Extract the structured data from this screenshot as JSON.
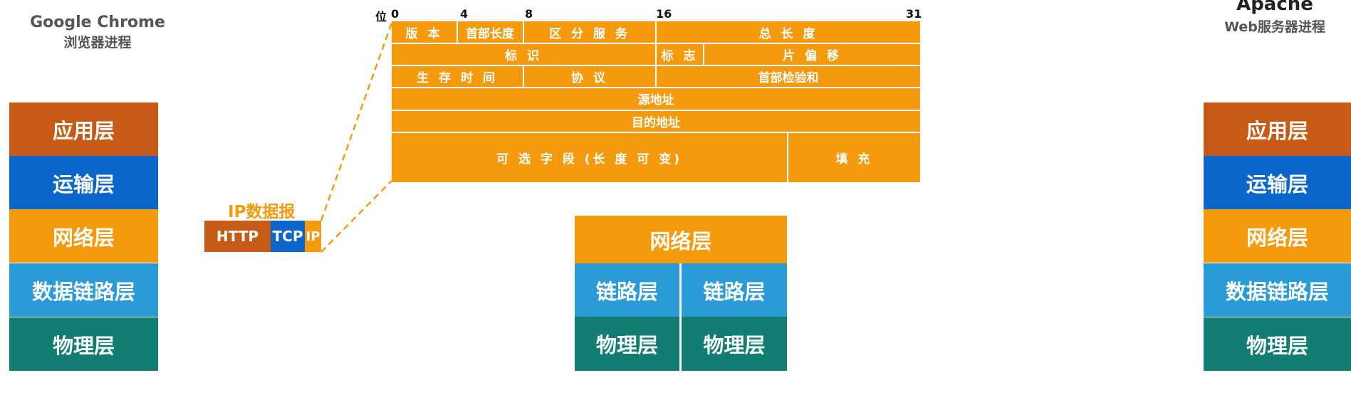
{
  "left_host": {
    "title": "Google Chrome",
    "subtitle": "浏览器进程",
    "layers": [
      "应用层",
      "运输层",
      "网络层",
      "数据链路层",
      "物理层"
    ]
  },
  "right_host": {
    "title": "Apache",
    "subtitle": "Web服务器进程",
    "layers": [
      "应用层",
      "运输层",
      "网络层",
      "数据链路层",
      "物理层"
    ]
  },
  "packet": {
    "label": "IP数据报",
    "segments": [
      "HTTP",
      "TCP",
      "IP"
    ]
  },
  "ip_header": {
    "bit_prefix": "位",
    "bits": [
      "0",
      "4",
      "8",
      "16",
      "31"
    ],
    "row1": [
      "版 本",
      "首部长度",
      "区 分 服 务",
      "总 长 度"
    ],
    "row2": [
      "标 识",
      "标 志",
      "片 偏 移"
    ],
    "row3": [
      "生 存 时 间",
      "协 议",
      "首部检验和"
    ],
    "row4": [
      "源地址"
    ],
    "row5": [
      "目的地址"
    ],
    "row6": [
      "可 选 字 段 (长 度 可 变)",
      "填 充"
    ]
  },
  "router": {
    "network": "网络层",
    "links": [
      "链路层",
      "链路层"
    ],
    "physicals": [
      "物理层",
      "物理层"
    ]
  },
  "colors": {
    "application": "#c75a17",
    "transport": "#0a66c8",
    "network": "#f59a0c",
    "datalink": "#2a9bd6",
    "physical": "#117d73",
    "header": "#f59a0c",
    "caption": "#555555"
  }
}
